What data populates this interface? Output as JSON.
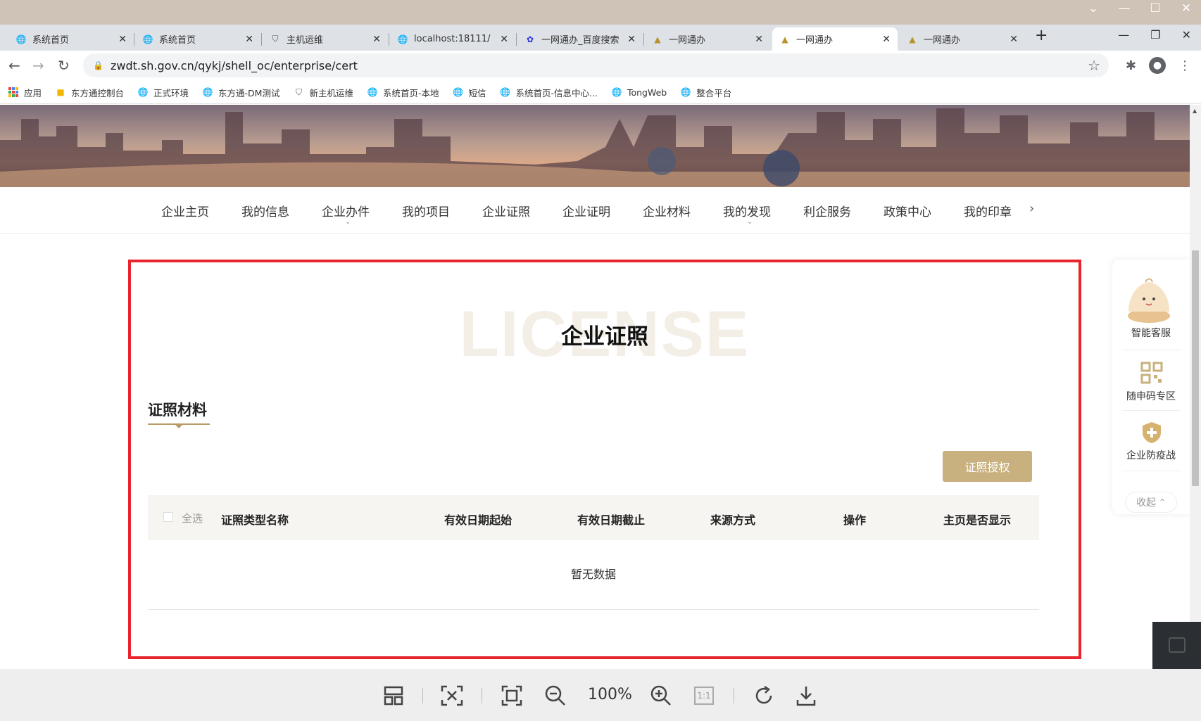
{
  "browser": {
    "tabs": [
      {
        "title": "系统首页",
        "icon": "globe-icon",
        "active": false
      },
      {
        "title": "系统首页",
        "icon": "globe-icon",
        "active": false
      },
      {
        "title": "主机运维",
        "icon": "shield-icon",
        "active": false
      },
      {
        "title": "localhost:18111/",
        "icon": "globe-icon",
        "active": false
      },
      {
        "title": "一网通办_百度搜索",
        "icon": "baidu-paw-icon",
        "active": false
      },
      {
        "title": "一网通办",
        "icon": "bell-icon",
        "active": false
      },
      {
        "title": "一网通办",
        "icon": "bell-icon",
        "active": true
      },
      {
        "title": "一网通办",
        "icon": "bell-icon",
        "active": false
      }
    ],
    "url": "zwdt.sh.gov.cn/qykj/shell_oc/enterprise/cert",
    "bookmarks": [
      {
        "label": "应用",
        "icon": "apps-grid-icon"
      },
      {
        "label": "东方通控制台",
        "icon": "folder-icon"
      },
      {
        "label": "正式环境",
        "icon": "globe-icon"
      },
      {
        "label": "东方通-DM测试",
        "icon": "globe-icon"
      },
      {
        "label": "新主机运维",
        "icon": "shield-icon"
      },
      {
        "label": "系统首页-本地",
        "icon": "globe-icon"
      },
      {
        "label": "短信",
        "icon": "globe-icon"
      },
      {
        "label": "系统首页-信息中心...",
        "icon": "globe-icon"
      },
      {
        "label": "TongWeb",
        "icon": "globe-icon"
      },
      {
        "label": "整合平台",
        "icon": "globe-icon"
      }
    ]
  },
  "nav": {
    "items": [
      "企业主页",
      "我的信息",
      "企业办件",
      "我的项目",
      "企业证照",
      "企业证明",
      "企业材料",
      "我的发现",
      "利企服务",
      "政策中心",
      "我的印章"
    ]
  },
  "content": {
    "bg_word": "LICENSE",
    "title": "企业证照",
    "subtitle": "证照材料",
    "auth_button": "证照授权",
    "select_all": "全选",
    "columns": [
      "证照类型名称",
      "有效日期起始",
      "有效日期截止",
      "来源方式",
      "操作",
      "主页是否显示"
    ],
    "empty_text": "暂无数据"
  },
  "float_panel": {
    "service": "智能客服",
    "qr": "随申码专区",
    "epidemic": "企业防疫战",
    "collapse": "收起"
  },
  "viewer": {
    "zoom": "100%",
    "one_to_one": "1:1"
  },
  "colors": {
    "accent_gold": "#c9b07f",
    "highlight_red": "#e8242e"
  }
}
